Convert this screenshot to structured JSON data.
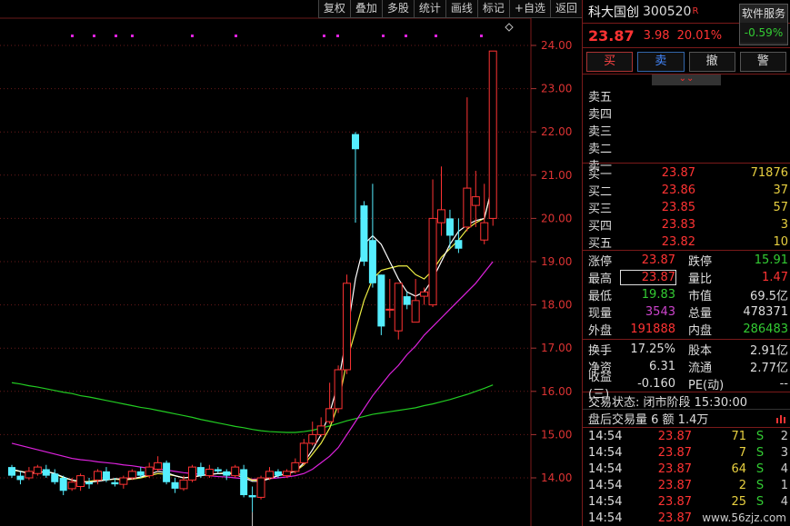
{
  "toolbar": [
    "复权",
    "叠加",
    "多股",
    "统计",
    "画线",
    "标记",
    "+自选",
    "返回"
  ],
  "stock": {
    "name": "科大国创",
    "code": "300520",
    "badge": "R",
    "price": "23.87",
    "change": "3.98",
    "pct": "20.01%"
  },
  "service": {
    "label": "软件服务",
    "value": "-0.59%"
  },
  "trade_buttons": [
    "买",
    "卖",
    "撤",
    "警"
  ],
  "collapse_icon": "chevrons-down-icon",
  "sell_book": [
    {
      "label": "卖五",
      "price": "",
      "vol": ""
    },
    {
      "label": "卖四",
      "price": "",
      "vol": ""
    },
    {
      "label": "卖三",
      "price": "",
      "vol": ""
    },
    {
      "label": "卖二",
      "price": "",
      "vol": ""
    },
    {
      "label": "卖一",
      "price": "",
      "vol": ""
    }
  ],
  "buy_book": [
    {
      "label": "买一",
      "price": "23.87",
      "vol": "71876"
    },
    {
      "label": "买二",
      "price": "23.86",
      "vol": "37"
    },
    {
      "label": "买三",
      "price": "23.85",
      "vol": "57"
    },
    {
      "label": "买四",
      "price": "23.83",
      "vol": "3"
    },
    {
      "label": "买五",
      "price": "23.82",
      "vol": "10"
    }
  ],
  "stats1": [
    {
      "k1": "涨停",
      "v1": "23.87",
      "c1": "red",
      "k2": "跌停",
      "v2": "15.91",
      "c2": "green"
    },
    {
      "k1": "最高",
      "v1": "23.87",
      "c1": "red",
      "k2": "量比",
      "v2": "1.47",
      "c2": "red"
    },
    {
      "k1": "最低",
      "v1": "19.83",
      "c1": "green",
      "k2": "市值",
      "v2": "69.5亿",
      "c2": "white"
    },
    {
      "k1": "现量",
      "v1": "3543",
      "c1": "purple",
      "k2": "总量",
      "v2": "478371",
      "c2": "white"
    },
    {
      "k1": "外盘",
      "v1": "191888",
      "c1": "red",
      "k2": "内盘",
      "v2": "286483",
      "c2": "green"
    }
  ],
  "stats2": [
    {
      "k1": "换手",
      "v1": "17.25%",
      "c1": "white",
      "k2": "股本",
      "v2": "2.91亿",
      "c2": "white"
    },
    {
      "k1": "净资",
      "v1": "6.31",
      "c1": "white",
      "k2": "流通",
      "v2": "2.77亿",
      "c2": "white"
    },
    {
      "k1": "收益(三)",
      "v1": "-0.160",
      "c1": "white",
      "k2": "PE(动)",
      "v2": "--",
      "c2": "white"
    }
  ],
  "trade_state": "交易状态: 闭市阶段 15:30:00",
  "after_hours": "盘后交易量 6 额 1.4万",
  "ticks": [
    {
      "t": "14:54",
      "p": "23.87",
      "v": "71",
      "s": "S",
      "n": "2"
    },
    {
      "t": "14:54",
      "p": "23.87",
      "v": "7",
      "s": "S",
      "n": "3"
    },
    {
      "t": "14:54",
      "p": "23.87",
      "v": "64",
      "s": "S",
      "n": "4"
    },
    {
      "t": "14:54",
      "p": "23.87",
      "v": "2",
      "s": "S",
      "n": "1"
    },
    {
      "t": "14:54",
      "p": "23.87",
      "v": "25",
      "s": "S",
      "n": "4"
    },
    {
      "t": "14:54",
      "p": "23.87",
      "v": "",
      "s": "",
      "n": ""
    }
  ],
  "watermark": "www.56zjz.com",
  "chart_data": {
    "type": "candlestick",
    "y_ticks": [
      "24.00",
      "23.00",
      "22.00",
      "21.00",
      "20.00",
      "19.00",
      "18.00",
      "17.00",
      "16.00",
      "15.00",
      "14.00"
    ],
    "ylim": [
      13.0,
      24.9
    ],
    "min_label": "13.21",
    "candles": [
      [
        14.25,
        14.05,
        14.3,
        14.0
      ],
      [
        14.05,
        13.95,
        14.15,
        13.85
      ],
      [
        14.0,
        14.15,
        14.25,
        13.95
      ],
      [
        14.1,
        14.25,
        14.3,
        14.05
      ],
      [
        14.2,
        14.05,
        14.3,
        14.0
      ],
      [
        14.1,
        13.9,
        14.2,
        13.85
      ],
      [
        14.0,
        13.7,
        14.05,
        13.6
      ],
      [
        13.75,
        13.9,
        14.0,
        13.7
      ],
      [
        13.8,
        14.05,
        14.1,
        13.7
      ],
      [
        13.9,
        13.85,
        14.0,
        13.75
      ],
      [
        13.95,
        14.15,
        14.2,
        13.85
      ],
      [
        14.15,
        13.95,
        14.25,
        13.9
      ],
      [
        13.9,
        13.85,
        14.0,
        13.8
      ],
      [
        13.85,
        14.0,
        14.05,
        13.75
      ],
      [
        14.0,
        14.15,
        14.2,
        13.95
      ],
      [
        14.15,
        14.05,
        14.25,
        14.0
      ],
      [
        14.05,
        14.25,
        14.35,
        14.0
      ],
      [
        14.2,
        14.35,
        14.5,
        14.15
      ],
      [
        14.35,
        13.9,
        14.4,
        13.85
      ],
      [
        13.9,
        13.75,
        14.0,
        13.65
      ],
      [
        13.75,
        13.95,
        14.05,
        13.7
      ],
      [
        13.95,
        14.25,
        14.3,
        13.9
      ],
      [
        14.25,
        14.05,
        14.35,
        14.0
      ],
      [
        14.05,
        14.2,
        14.3,
        14.0
      ],
      [
        14.2,
        14.15,
        14.25,
        14.1
      ],
      [
        14.15,
        14.05,
        14.2,
        13.95
      ],
      [
        14.05,
        14.25,
        14.3,
        14.0
      ],
      [
        14.2,
        13.6,
        14.3,
        13.55
      ],
      [
        13.6,
        13.55,
        13.8,
        13.21
      ],
      [
        13.55,
        14.0,
        14.05,
        13.5
      ],
      [
        14.0,
        14.15,
        14.25,
        13.95
      ],
      [
        14.15,
        14.05,
        14.2,
        14.0
      ],
      [
        14.05,
        14.15,
        14.2,
        14.0
      ],
      [
        14.15,
        14.35,
        14.45,
        14.1
      ],
      [
        14.35,
        14.8,
        14.9,
        14.3
      ],
      [
        14.8,
        15.0,
        15.3,
        14.75
      ],
      [
        15.0,
        15.2,
        15.4,
        14.95
      ],
      [
        15.3,
        15.6,
        16.2,
        15.25
      ],
      [
        15.6,
        16.5,
        16.6,
        15.5
      ],
      [
        16.5,
        18.5,
        18.7,
        16.4
      ],
      [
        21.95,
        21.6,
        22.0,
        19.9
      ],
      [
        20.3,
        19.0,
        20.4,
        18.9
      ],
      [
        19.5,
        18.5,
        20.8,
        18.4
      ],
      [
        18.7,
        17.5,
        18.7,
        17.3
      ],
      [
        17.9,
        17.9,
        18.6,
        17.7
      ],
      [
        17.4,
        18.5,
        18.5,
        17.2
      ],
      [
        18.2,
        18.0,
        18.3,
        17.9
      ],
      [
        17.6,
        18.1,
        18.6,
        17.6
      ],
      [
        18.2,
        18.3,
        18.4,
        18.0
      ],
      [
        18.0,
        20.0,
        20.9,
        17.95
      ],
      [
        19.9,
        20.2,
        21.2,
        19.6
      ],
      [
        20.0,
        19.6,
        20.2,
        19.3
      ],
      [
        19.5,
        19.3,
        20.0,
        19.2
      ],
      [
        19.8,
        20.7,
        22.8,
        19.7
      ],
      [
        20.3,
        20.5,
        21.1,
        19.8
      ],
      [
        19.5,
        19.9,
        20.8,
        19.4
      ],
      [
        20.0,
        23.87,
        23.87,
        19.83
      ]
    ],
    "ma_yellow": [
      14.18,
      14.15,
      14.12,
      14.12,
      14.15,
      14.1,
      14.0,
      13.95,
      13.9,
      13.92,
      13.95,
      13.95,
      13.97,
      13.95,
      13.97,
      14.0,
      14.05,
      14.1,
      14.08,
      14.05,
      14.0,
      14.02,
      14.05,
      14.08,
      14.1,
      14.12,
      14.12,
      14.05,
      13.95,
      13.95,
      13.98,
      14.05,
      14.1,
      14.15,
      14.3,
      14.55,
      14.8,
      15.15,
      15.7,
      16.7,
      17.4,
      18.1,
      18.6,
      18.8,
      18.85,
      18.9,
      18.9,
      18.7,
      18.6,
      18.8,
      19.1,
      19.3,
      19.5,
      19.75,
      19.9,
      20.0,
      20.8
    ],
    "ma_white": [
      14.2,
      14.15,
      14.1,
      14.12,
      14.15,
      14.1,
      14.02,
      13.95,
      13.92,
      13.9,
      13.92,
      13.95,
      13.98,
      13.97,
      13.98,
      14.02,
      14.08,
      14.15,
      14.12,
      14.05,
      14.0,
      14.02,
      14.05,
      14.08,
      14.1,
      14.1,
      14.08,
      14.0,
      13.92,
      13.92,
      13.98,
      14.05,
      14.1,
      14.15,
      14.35,
      14.65,
      15.0,
      15.5,
      16.2,
      17.3,
      18.6,
      19.4,
      19.6,
      19.4,
      19.0,
      18.6,
      18.3,
      18.2,
      18.3,
      18.6,
      19.0,
      19.4,
      19.7,
      19.85,
      19.95,
      20.0,
      20.8
    ],
    "ma_magenta": [
      14.8,
      14.75,
      14.7,
      14.65,
      14.6,
      14.55,
      14.5,
      14.45,
      14.42,
      14.4,
      14.37,
      14.35,
      14.33,
      14.3,
      14.28,
      14.25,
      14.22,
      14.2,
      14.18,
      14.15,
      14.12,
      14.1,
      14.08,
      14.05,
      14.03,
      14.02,
      14.0,
      13.98,
      13.97,
      13.97,
      13.98,
      14.0,
      14.02,
      14.05,
      14.1,
      14.2,
      14.35,
      14.5,
      14.7,
      15.0,
      15.3,
      15.6,
      15.9,
      16.15,
      16.4,
      16.6,
      16.85,
      17.05,
      17.3,
      17.5,
      17.7,
      17.9,
      18.1,
      18.3,
      18.5,
      18.75,
      19.0
    ],
    "ma_green": [
      16.2,
      16.17,
      16.13,
      16.1,
      16.06,
      16.02,
      15.98,
      15.95,
      15.9,
      15.87,
      15.83,
      15.79,
      15.75,
      15.71,
      15.67,
      15.63,
      15.6,
      15.56,
      15.52,
      15.48,
      15.44,
      15.4,
      15.35,
      15.31,
      15.27,
      15.23,
      15.19,
      15.16,
      15.12,
      15.09,
      15.07,
      15.06,
      15.05,
      15.05,
      15.07,
      15.1,
      15.15,
      15.2,
      15.26,
      15.32,
      15.37,
      15.42,
      15.47,
      15.5,
      15.53,
      15.56,
      15.59,
      15.62,
      15.67,
      15.71,
      15.76,
      15.81,
      15.87,
      15.93,
      16.0,
      16.07,
      16.15
    ]
  }
}
